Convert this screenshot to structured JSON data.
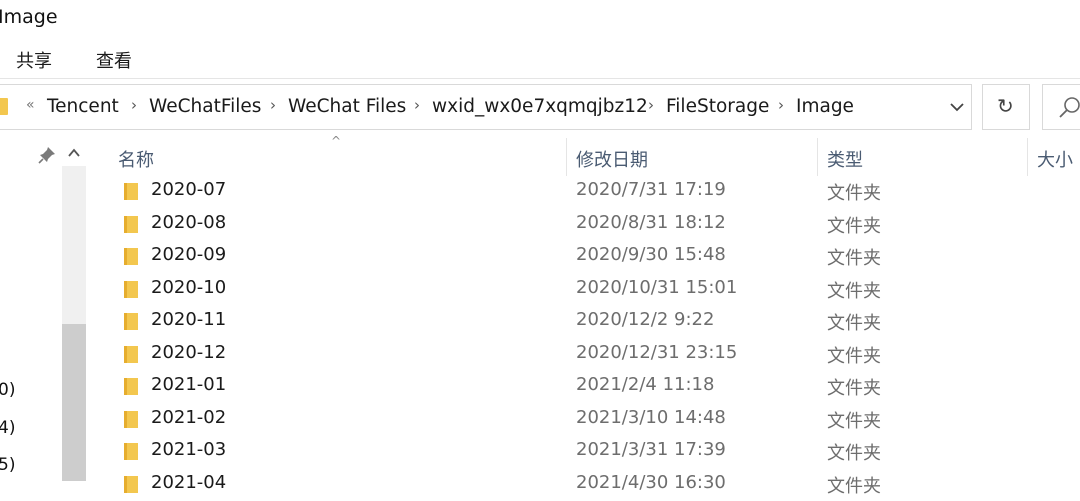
{
  "window": {
    "title": "Image"
  },
  "ribbon": {
    "tabs": [
      {
        "label": "共享"
      },
      {
        "label": "查看"
      }
    ]
  },
  "address_bar": {
    "overflow": "«",
    "crumbs": [
      {
        "label": "Tencent"
      },
      {
        "label": "WeChatFiles"
      },
      {
        "label": "WeChat Files"
      },
      {
        "label": "wxid_wx0e7xqmqjbz12"
      },
      {
        "label": "FileStorage"
      },
      {
        "label": "Image"
      }
    ],
    "separator": "›",
    "refresh_glyph": "↻"
  },
  "nav_pane": {
    "fragments": [
      {
        "text": "0)"
      },
      {
        "text": "4)"
      },
      {
        "text": "5)"
      }
    ]
  },
  "columns": {
    "sort_glyph": "^",
    "name": "名称",
    "date": "修改日期",
    "type": "类型",
    "size": "大小"
  },
  "files": [
    {
      "name": "2020-07",
      "date": "2020/7/31 17:19",
      "type": "文件夹"
    },
    {
      "name": "2020-08",
      "date": "2020/8/31 18:12",
      "type": "文件夹"
    },
    {
      "name": "2020-09",
      "date": "2020/9/30 15:48",
      "type": "文件夹"
    },
    {
      "name": "2020-10",
      "date": "2020/10/31 15:01",
      "type": "文件夹"
    },
    {
      "name": "2020-11",
      "date": "2020/12/2 9:22",
      "type": "文件夹"
    },
    {
      "name": "2020-12",
      "date": "2020/12/31 23:15",
      "type": "文件夹"
    },
    {
      "name": "2021-01",
      "date": "2021/2/4 11:18",
      "type": "文件夹"
    },
    {
      "name": "2021-02",
      "date": "2021/3/10 14:48",
      "type": "文件夹"
    },
    {
      "name": "2021-03",
      "date": "2021/3/31 17:39",
      "type": "文件夹"
    },
    {
      "name": "2021-04",
      "date": "2021/4/30 16:30",
      "type": "文件夹"
    }
  ],
  "colors": {
    "folder": "#f3c74f",
    "folder_shade": "#e6ad2e",
    "header_text": "#4a5b72",
    "meta_text": "#6d6d6d",
    "border": "#d9d9d9"
  },
  "icons": {
    "folder": "folder-icon",
    "pin": "pin-icon",
    "refresh": "refresh-icon",
    "search": "search-icon",
    "dropdown": "chevron-down-icon",
    "scroll_up": "scroll-up-arrow-icon"
  }
}
